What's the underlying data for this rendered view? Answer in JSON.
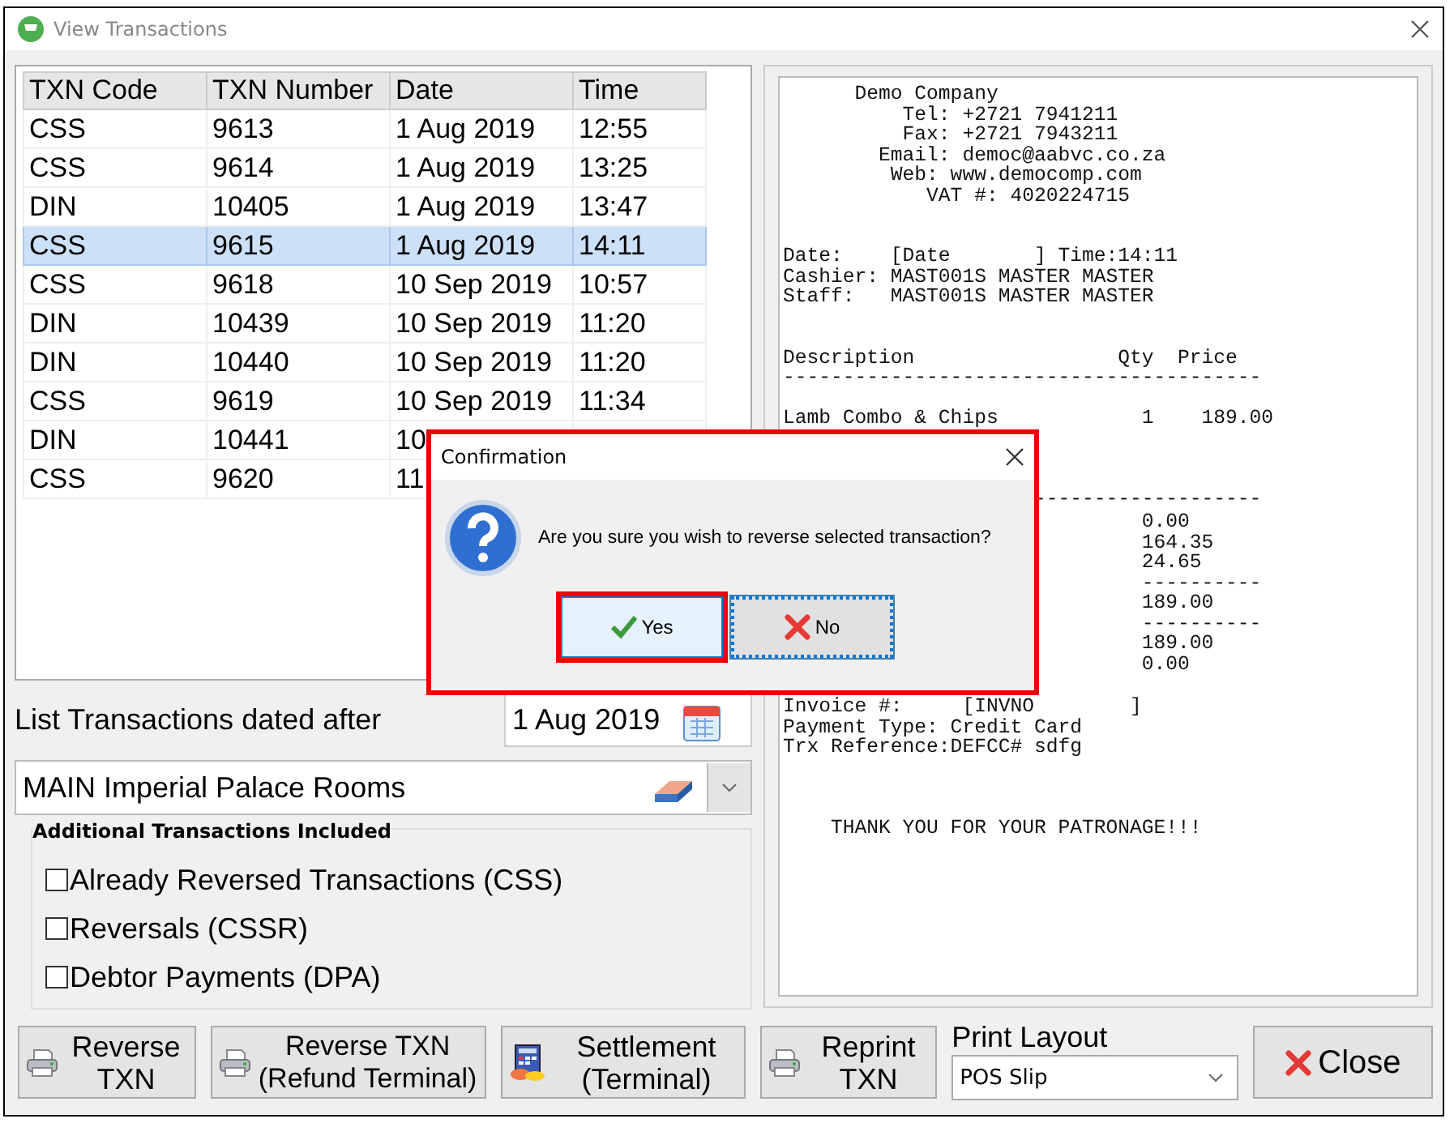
{
  "window": {
    "title": "View Transactions"
  },
  "table": {
    "columns": [
      "TXN Code",
      "TXN Number",
      "Date",
      "Time"
    ],
    "rows": [
      {
        "cells": [
          "CSS",
          "9613",
          "1 Aug 2019",
          "12:55"
        ],
        "selected": false
      },
      {
        "cells": [
          "CSS",
          "9614",
          "1 Aug 2019",
          "13:25"
        ],
        "selected": false
      },
      {
        "cells": [
          "DIN",
          "10405",
          "1 Aug 2019",
          "13:47"
        ],
        "selected": false
      },
      {
        "cells": [
          "CSS",
          "9615",
          "1 Aug 2019",
          "14:11"
        ],
        "selected": true
      },
      {
        "cells": [
          "CSS",
          "9618",
          "10 Sep 2019",
          "10:57"
        ],
        "selected": false
      },
      {
        "cells": [
          "DIN",
          "10439",
          "10 Sep 2019",
          "11:20"
        ],
        "selected": false
      },
      {
        "cells": [
          "DIN",
          "10440",
          "10 Sep 2019",
          "11:20"
        ],
        "selected": false
      },
      {
        "cells": [
          "CSS",
          "9619",
          "10 Sep 2019",
          "11:34"
        ],
        "selected": false
      },
      {
        "cells": [
          "DIN",
          "10441",
          "10"
        ],
        "selected": false
      },
      {
        "cells": [
          "CSS",
          "9620",
          "11"
        ],
        "selected": false
      }
    ]
  },
  "date_filter": {
    "label": "List Transactions dated after",
    "value": "1 Aug 2019"
  },
  "location": {
    "value": "MAIN Imperial Palace Rooms"
  },
  "additional": {
    "title": "Additional Transactions Included",
    "options": [
      {
        "label": "Already Reversed Transactions (CSS)",
        "checked": false
      },
      {
        "label": "Reversals (CSSR)",
        "checked": false
      },
      {
        "label": "Debtor Payments (DPA)",
        "checked": false
      }
    ]
  },
  "receipt": {
    "blocks": [
      {
        "kind": "header",
        "lines": [
          "      Demo Company",
          "          Tel: +2721 7941211",
          "          Fax: +2721 7943211",
          "        Email: democ@aabvc.co.za",
          "         Web: www.democomp.com",
          "            VAT #: 4020224715"
        ]
      },
      {
        "kind": "info",
        "lines": [
          "Date:    [Date       ] Time:14:11",
          "Cashier: MAST001S MASTER MASTER",
          "Staff:   MAST001S MASTER MASTER"
        ]
      },
      {
        "kind": "columns",
        "lines": [
          "Description                 Qty  Price",
          "----------------------------------------"
        ]
      },
      {
        "kind": "item",
        "lines": [
          "Lamb Combo & Chips            1    189.00"
        ]
      },
      {
        "kind": "rule",
        "lines": [
          "-------------------"
        ]
      },
      {
        "kind": "amounts",
        "lines": [
          "0.00",
          "164.35",
          "24.65",
          "----------",
          "189.00",
          "----------",
          "189.00",
          "0.00"
        ]
      },
      {
        "kind": "payment",
        "lines": [
          "Invoice #:     [INVNO        ]",
          "Payment Type: Credit Card",
          "Trx Reference:DEFCC# sdfg"
        ]
      },
      {
        "kind": "footer",
        "lines": [
          "    THANK YOU FOR YOUR PATRONAGE!!!"
        ]
      }
    ]
  },
  "buttons": [
    {
      "kind": "printer",
      "label": "Reverse TXN"
    },
    {
      "kind": "printer",
      "label": "Reverse TXN (Refund Terminal)"
    },
    {
      "kind": "settlement",
      "label": "Settlement (Terminal)"
    },
    {
      "kind": "printer",
      "label": "Reprint TXN"
    }
  ],
  "print_layout": {
    "label": "Print Layout",
    "value": "POS Slip"
  },
  "close_button": {
    "label": "Close"
  },
  "dialog": {
    "title": "Confirmation",
    "message": "Are you sure you wish to reverse selected transaction?",
    "annotated": true,
    "buttons": [
      {
        "kind": "yes",
        "label": "Yes",
        "hovered": true,
        "focused": false,
        "annotated": true
      },
      {
        "kind": "no",
        "label": "No",
        "hovered": false,
        "focused": true,
        "annotated": false
      }
    ]
  }
}
